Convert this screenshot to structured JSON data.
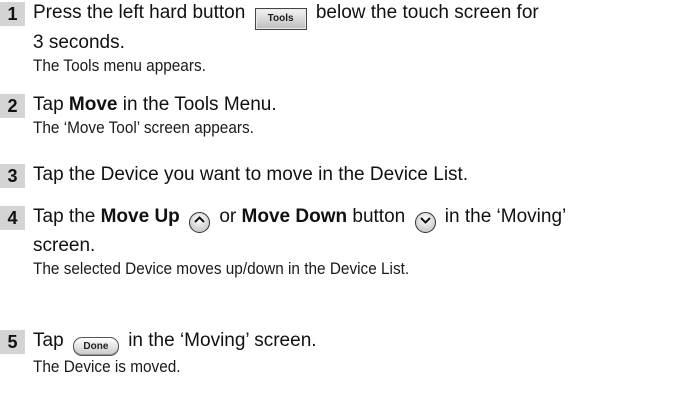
{
  "steps": [
    {
      "number": "1",
      "line1_a": "Press the left hard button",
      "button_label": "Tools",
      "line1_b": "below the touch screen for",
      "line2": "3 seconds.",
      "result": "The Tools menu appears."
    },
    {
      "number": "2",
      "a": "Tap",
      "bold": "Move",
      "b": "in the Tools Menu.",
      "result": "The ‘Move Tool’ screen appears."
    },
    {
      "number": "3",
      "text": "Tap the Device you want to move in the Device List."
    },
    {
      "number": "4",
      "a": "Tap the",
      "bold1": "Move Up",
      "b": "or",
      "bold2": "Move Down",
      "c": "button",
      "d": "in the ‘Moving’",
      "line2": "screen.",
      "result": "The selected Device moves up/down in the Device List."
    },
    {
      "number": "5",
      "a": "Tap",
      "button_label": "Done",
      "b": "in the ‘Moving’ screen.",
      "result": "The Device is moved."
    }
  ]
}
